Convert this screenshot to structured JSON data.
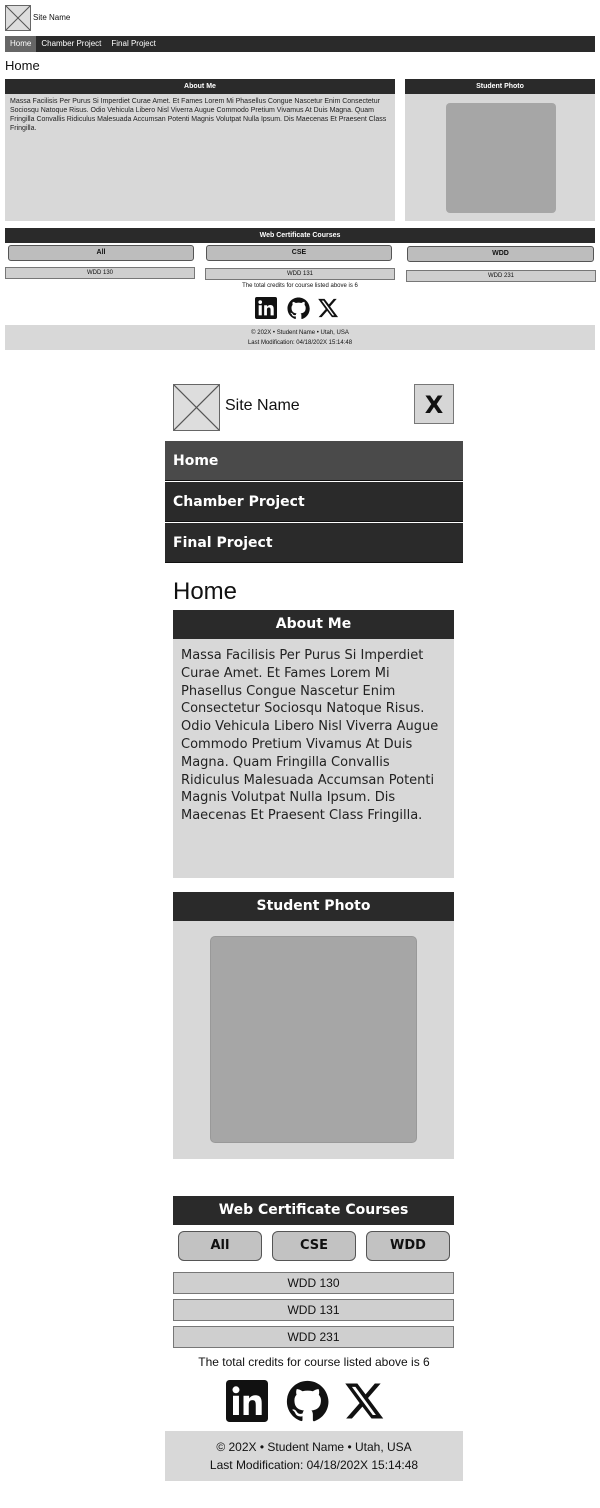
{
  "site": {
    "name": "Site Name",
    "logo_icon": "placeholder-image-icon"
  },
  "nav": {
    "items": [
      "Home",
      "Chamber Project",
      "Final Project"
    ],
    "active": "Home",
    "close_label": "X"
  },
  "page": {
    "heading": "Home"
  },
  "about": {
    "title": "About Me",
    "text": "Massa Facilisis Per Purus Si Imperdiet Curae Amet. Et Fames Lorem Mi Phasellus Congue Nascetur Enim Consectetur Sociosqu Natoque Risus. Odio Vehicula Libero Nisl Viverra Augue Commodo Pretium Vivamus At Duis Magna. Quam Fringilla Convallis Ridiculus Malesuada Accumsan Potenti Magnis Volutpat Nulla Ipsum. Dis Maecenas Et Praesent Class Fringilla."
  },
  "photo": {
    "title": "Student Photo"
  },
  "courses": {
    "title": "Web Certificate Courses",
    "filters": [
      "All",
      "CSE",
      "WDD"
    ],
    "list": [
      "WDD 130",
      "WDD 131",
      "WDD 231"
    ],
    "credits_text": "The total credits for course listed above is 6"
  },
  "social": {
    "icons": [
      "linkedin-icon",
      "github-icon",
      "x-icon"
    ]
  },
  "footer": {
    "line1": "© 202X • Student Name • Utah, USA",
    "line2": "Last Modification: 04/18/202X 15:14:48"
  },
  "colors": {
    "nav_bg": "#2a2a2a",
    "card_bg": "#d8d8d8",
    "photo_placeholder": "#a6a6a6"
  }
}
